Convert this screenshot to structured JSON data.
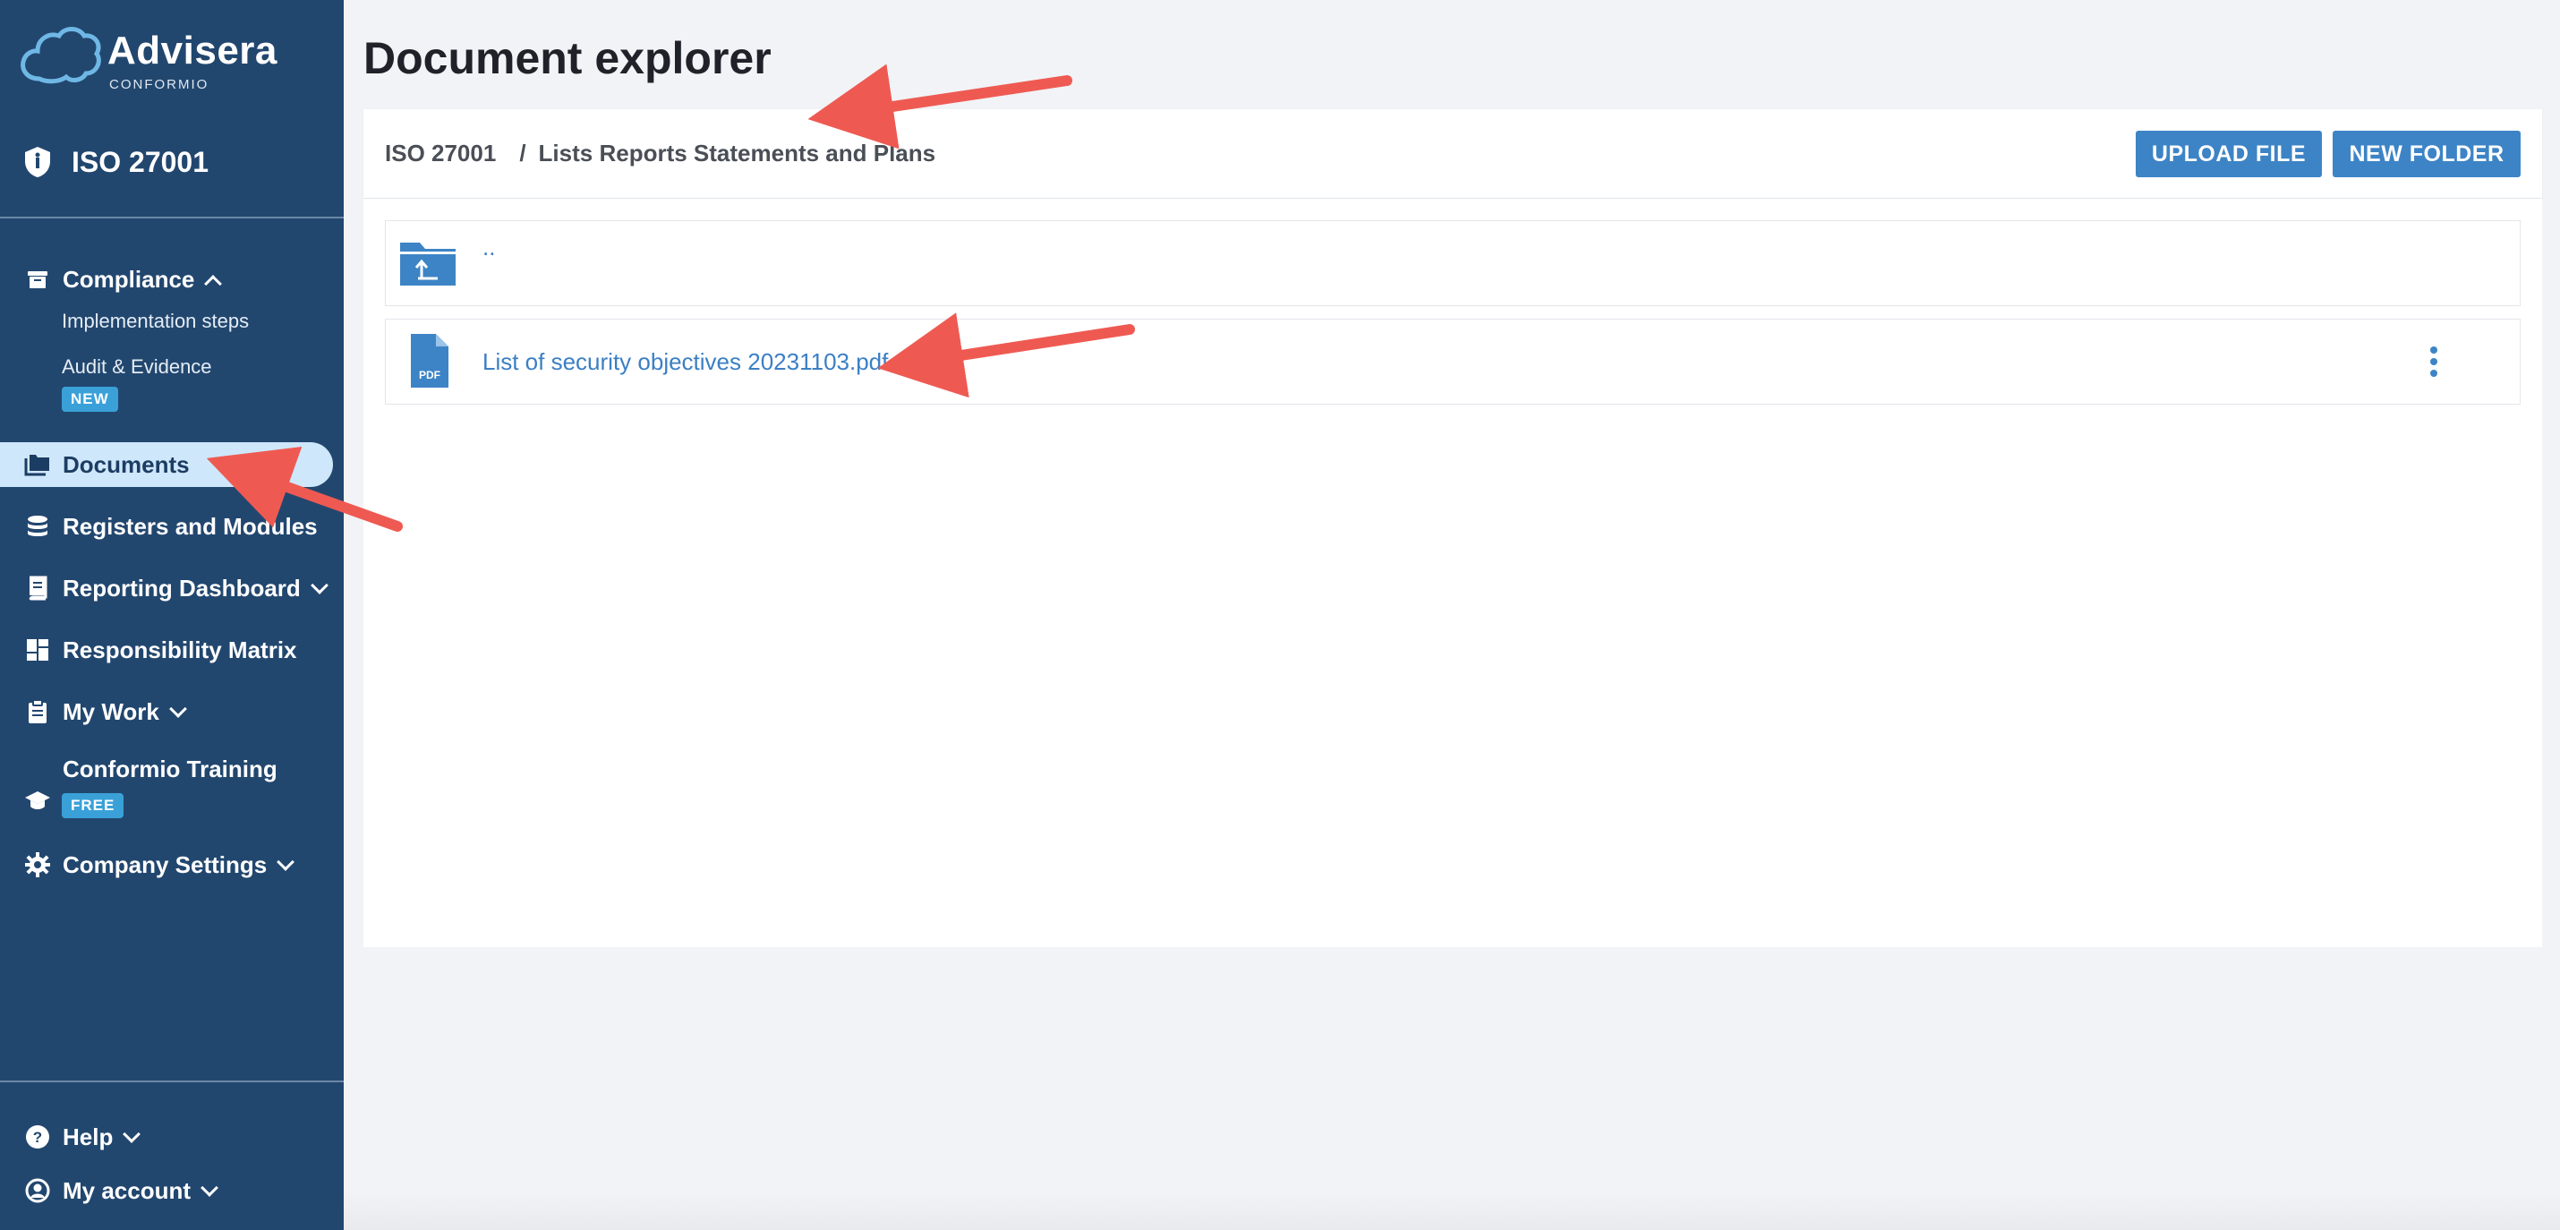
{
  "brand": {
    "name": "Advisera",
    "sub": "CONFORMIO"
  },
  "product": {
    "label": "ISO 27001"
  },
  "sidebar": {
    "compliance": "Compliance",
    "implementation_steps": "Implementation steps",
    "audit_evidence": "Audit & Evidence",
    "audit_badge": "NEW",
    "documents": "Documents",
    "registers": "Registers and Modules",
    "reporting": "Reporting Dashboard",
    "responsibility": "Responsibility Matrix",
    "my_work": "My Work",
    "training": "Conformio Training",
    "training_badge": "FREE",
    "company_settings": "Company Settings",
    "help": "Help",
    "my_account": "My account"
  },
  "main": {
    "title": "Document explorer",
    "breadcrumb": {
      "root": "ISO 27001",
      "separator": "/",
      "current": "Lists Reports Statements and Plans"
    },
    "upload_button": "UPLOAD FILE",
    "new_folder_button": "NEW FOLDER",
    "parent_folder": "..",
    "files": [
      {
        "name": "List of security objectives 20231103.pdf",
        "type_label": "PDF"
      }
    ]
  },
  "colors": {
    "sidebar": "#22476f",
    "accent": "#3d84c6",
    "active_bg": "#cfe7fb",
    "arrow": "#ee5a52"
  }
}
